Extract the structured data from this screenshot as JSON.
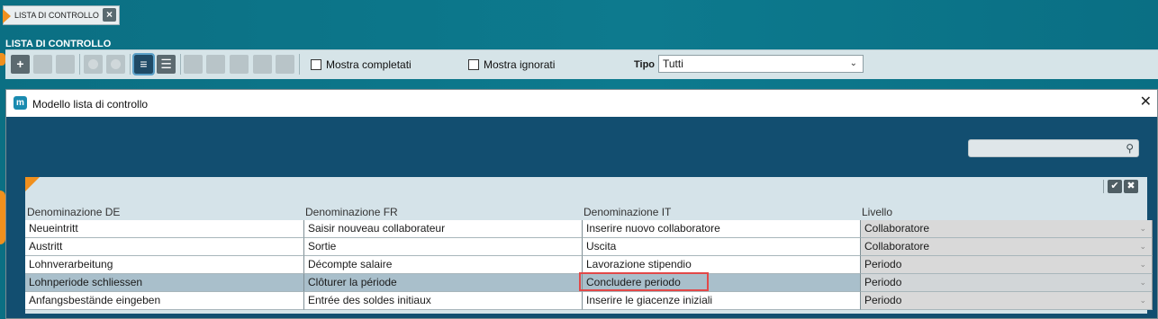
{
  "app": {
    "tab_label": "LISTA DI CONTROLLO",
    "section_title": "LISTA DI CONTROLLO"
  },
  "toolbar": {
    "show_completed_label": "Mostra completati",
    "show_ignored_label": "Mostra ignorati",
    "type_label": "Tipo",
    "type_value": "Tutti"
  },
  "modal": {
    "title": "Modello lista di controllo",
    "search_placeholder": "",
    "columns": [
      "Denominazione DE",
      "Denominazione FR",
      "Denominazione IT",
      "Livello"
    ],
    "rows": [
      {
        "de": "Neueintritt",
        "fr": "Saisir nouveau collaborateur",
        "it": "Inserire nuovo collaboratore",
        "level": "Collaboratore",
        "selected": false
      },
      {
        "de": "Austritt",
        "fr": "Sortie",
        "it": "Uscita",
        "level": "Collaboratore",
        "selected": false
      },
      {
        "de": "Lohnverarbeitung",
        "fr": "Décompte salaire",
        "it": "Lavorazione stipendio",
        "level": "Periodo",
        "selected": false
      },
      {
        "de": "Lohnperiode schliessen",
        "fr": "Clôturer la période",
        "it": "Concludere periodo",
        "level": "Periodo",
        "selected": true
      },
      {
        "de": "Anfangsbestände eingeben",
        "fr": "Entrée des soldes initiaux",
        "it": "Inserire le giacenze iniziali",
        "level": "Periodo",
        "selected": false
      }
    ]
  },
  "colors": {
    "accent": "#f0901e",
    "modal_bg": "#124e70",
    "selected_row": "#a9bfcb",
    "highlight": "#e24848"
  }
}
